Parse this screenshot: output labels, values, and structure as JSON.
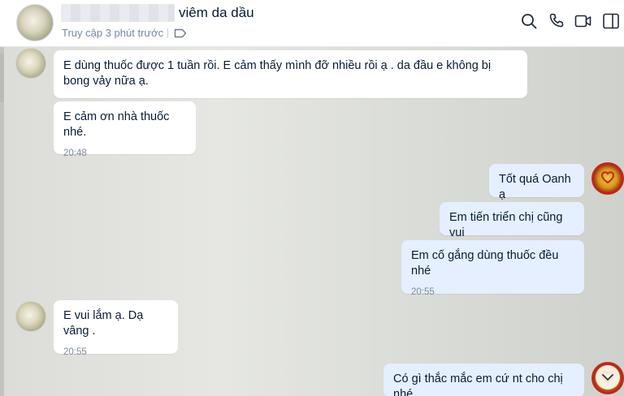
{
  "header": {
    "title": "viêm da dầu",
    "status": "Truy cập 3 phút trước",
    "icons": [
      "search-icon",
      "phone-icon",
      "video-icon",
      "layout-icon",
      "tag-icon"
    ]
  },
  "messages": [
    {
      "side": "them",
      "text": "E dùng thuốc được 1 tuần rồi. E cảm thấy mình đỡ nhiều rồi ạ . da đầu e không bị bong vảy nữa ạ.",
      "time": ""
    },
    {
      "side": "them",
      "text": "E cảm ơn nhà thuốc nhé.",
      "time": "20:48"
    },
    {
      "side": "me",
      "text": "Tốt quá Oanh ạ",
      "time": ""
    },
    {
      "side": "me",
      "text": "Em tiến triển chị cũng vui",
      "time": ""
    },
    {
      "side": "me",
      "text": "Em cố gắng dùng thuốc đều nhé",
      "time": "20:55"
    },
    {
      "side": "them",
      "text": "E vui lắm ạ. Dạ vâng .",
      "time": "20:55"
    },
    {
      "side": "me",
      "text": "Có gì thắc mắc em cứ nt cho chị nhé",
      "time": ""
    }
  ],
  "colors": {
    "my_bubble": "#e5efff",
    "their_bubble": "#ffffff",
    "text": "#081c36",
    "brand_red": "#c4281b"
  }
}
